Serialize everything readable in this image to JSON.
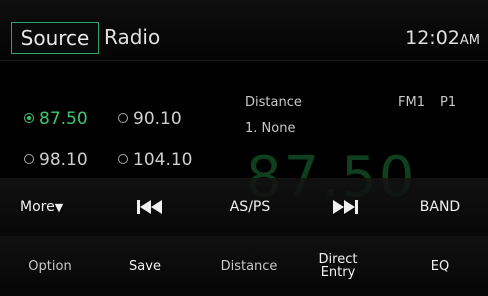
{
  "header": {
    "source_label": "Source",
    "title": "Radio",
    "clock_time": "12:02",
    "clock_ampm": "AM"
  },
  "presets": [
    {
      "freq": "87.50",
      "selected": true
    },
    {
      "freq": "90.10",
      "selected": false
    },
    {
      "freq": "98.10",
      "selected": false
    },
    {
      "freq": "104.10",
      "selected": false
    }
  ],
  "info": {
    "distance_label": "Distance",
    "distance_value": "1. None",
    "band": "FM1",
    "preset": "P1"
  },
  "current_frequency": "87.50",
  "controls": {
    "more_label": "More",
    "prev_icon": "skip-back-icon",
    "asps_label": "AS/PS",
    "next_icon": "skip-forward-icon",
    "band_label": "BAND"
  },
  "bottom_buttons": {
    "option": "Option",
    "save": "Save",
    "distance": "Distance",
    "direct_line1": "Direct",
    "direct_line2": "Entry",
    "eq": "EQ"
  },
  "colors": {
    "accent_green": "#3ec66e",
    "source_border": "#2fa36b",
    "big_freq": "#0f3f1f"
  }
}
